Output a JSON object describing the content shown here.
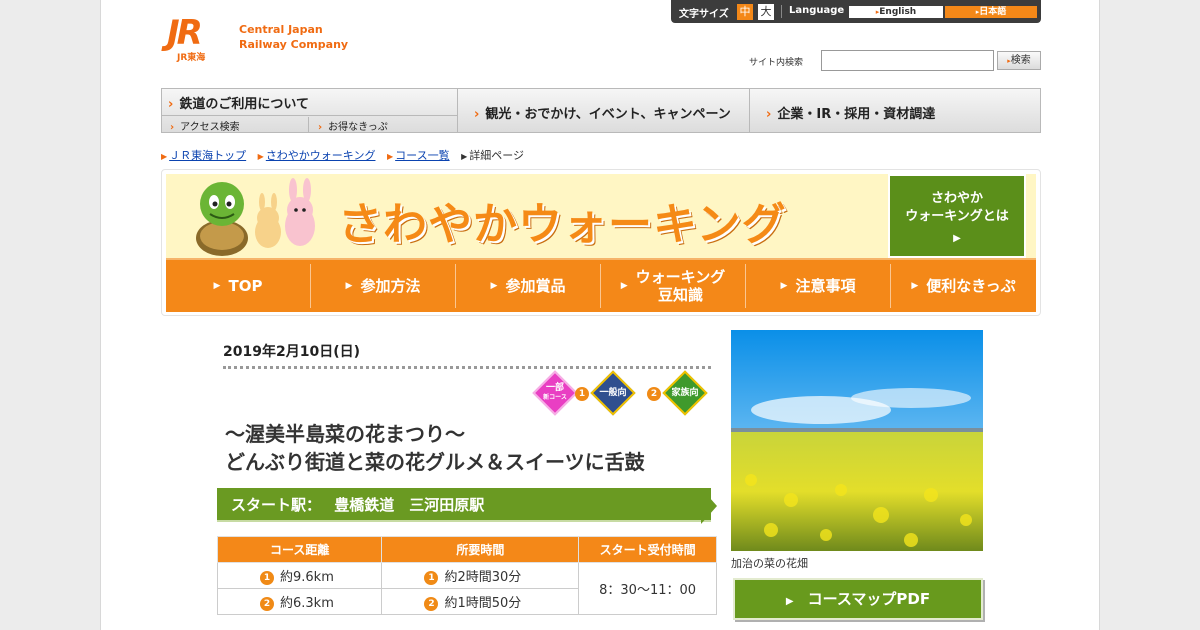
{
  "header": {
    "logo_mark": "JR",
    "logo_sub": "JR東海",
    "logo_line1": "Central Japan",
    "logo_line2": "Railway Company",
    "font_size_label": "文字サイズ",
    "font_size_options": [
      "中",
      "大"
    ],
    "language_label": "Language",
    "language_options": [
      "English",
      "日本語"
    ],
    "search_label": "サイト内検索",
    "search_value": "",
    "search_button": "検索"
  },
  "global_nav": {
    "rail": "鉄道のご利用について",
    "rail_sub1": "アクセス検索",
    "rail_sub2": "お得なきっぷ",
    "tourism": "観光・おでかけ、イベント、キャンペーン",
    "corporate": "企業・IR・採用・資材調達"
  },
  "breadcrumb": [
    "ＪＲ東海トップ",
    "さわやかウォーキング",
    "コース一覧",
    "詳細ページ"
  ],
  "banner": {
    "title": "さわやかウォーキング",
    "about_line1": "さわやか",
    "about_line2": "ウォーキングとは",
    "nav": [
      {
        "label": "TOP"
      },
      {
        "label": "参加方法"
      },
      {
        "label": "参加賞品"
      },
      {
        "label1": "ウォーキング",
        "label2": "豆知識"
      },
      {
        "label": "注意事項"
      },
      {
        "label": "便利なきっぷ"
      }
    ]
  },
  "event": {
    "date": "2019年2月10日(日)",
    "badges": [
      {
        "text1": "一部",
        "text2": "新コース",
        "color": "#e93fc3"
      },
      {
        "num": "1",
        "text1": "一般向",
        "color": "#2f4f8f"
      },
      {
        "num": "2",
        "text1": "家族向",
        "color": "#3f9a2c"
      }
    ],
    "title_line1": "～渥美半島菜の花まつり～",
    "title_line2": "どんぶり街道と菜の花グルメ＆スイーツに舌鼓",
    "start_label": "スタート駅：",
    "start_station": "豊橋鉄道　三河田原駅",
    "table": {
      "headers": [
        "コース距離",
        "所要時間",
        "スタート受付時間"
      ],
      "rows": [
        {
          "num": "1",
          "distance": "約9.6km",
          "time": "約2時間30分"
        },
        {
          "num": "2",
          "distance": "約6.3km",
          "time": "約1時間50分"
        }
      ],
      "reception": "8：30～11：00"
    },
    "photo_caption": "加治の菜の花畑",
    "pdf_button": "コースマップPDF"
  }
}
